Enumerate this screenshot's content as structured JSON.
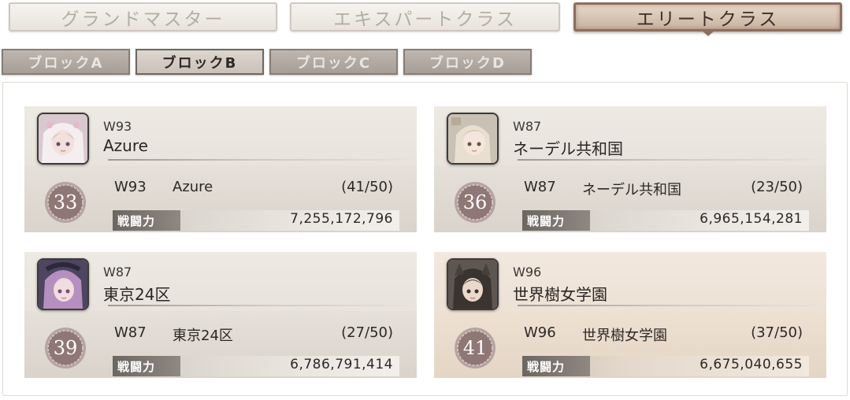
{
  "class_tabs": [
    {
      "label": "グランドマスター",
      "active": false
    },
    {
      "label": "エキスパートクラス",
      "active": false
    },
    {
      "label": "エリートクラス",
      "active": true
    }
  ],
  "block_tabs": [
    {
      "label": "ブロックA",
      "active": false
    },
    {
      "label": "ブロックB",
      "active": true
    },
    {
      "label": "ブロックC",
      "active": false
    },
    {
      "label": "ブロックD",
      "active": false
    }
  ],
  "guilds": [
    {
      "world": "W93",
      "name": "Azure",
      "rank": "33",
      "members": "(41/50)",
      "power_label": "戦闘力",
      "power": "7,255,172,796",
      "avatar_icon": "pink-hood-girl-avatar",
      "highlight": false
    },
    {
      "world": "W87",
      "name": "ネーデル共和国",
      "rank": "36",
      "members": "(23/50)",
      "power_label": "戦闘力",
      "power": "6,965,154,281",
      "avatar_icon": "blonde-girl-avatar",
      "highlight": false
    },
    {
      "world": "W87",
      "name": "東京24区",
      "rank": "39",
      "members": "(27/50)",
      "power_label": "戦闘力",
      "power": "6,786,791,414",
      "avatar_icon": "purple-hair-girl-avatar",
      "highlight": false
    },
    {
      "world": "W96",
      "name": "世界樹女学園",
      "rank": "41",
      "members": "(37/50)",
      "power_label": "戦闘力",
      "power": "6,675,040,655",
      "avatar_icon": "dark-hood-girl-avatar",
      "highlight": true
    }
  ],
  "colors": {
    "active_tab_border": "#8e6e5e",
    "rank_badge": "#8f7775",
    "highlight_card": "#efe3d6"
  }
}
